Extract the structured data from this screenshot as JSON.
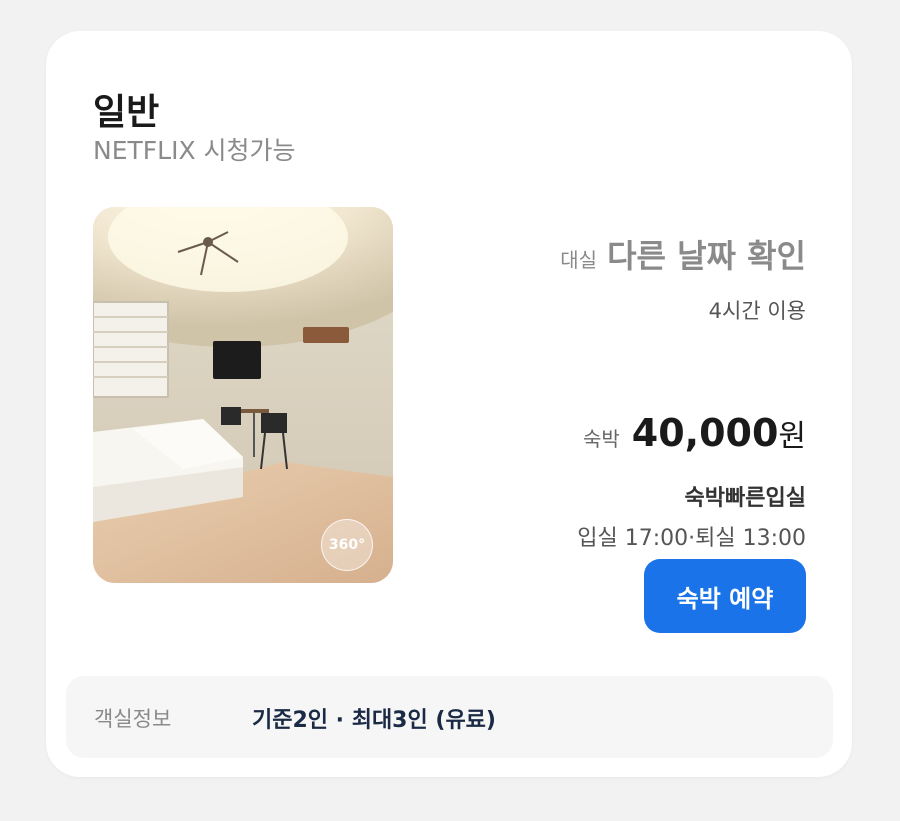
{
  "room": {
    "name": "일반",
    "feature": "NETFLIX 시청가능"
  },
  "photo": {
    "badge": "360°"
  },
  "day_use": {
    "label": "대실",
    "status": "다른 날짜 확인",
    "hours": "4시간 이용"
  },
  "stay": {
    "label": "숙박",
    "price": "40,000",
    "currency": "원",
    "promo": "숙박빠른입실",
    "times": "입실 17:00·퇴실 13:00",
    "book_label": "숙박 예약"
  },
  "info": {
    "label": "객실정보",
    "value": "기준2인 · 최대3인 (유료)"
  },
  "colors": {
    "accent": "#1a73e8",
    "background": "#f2f2f2",
    "card": "#ffffff",
    "info_panel": "#f6f6f6"
  }
}
